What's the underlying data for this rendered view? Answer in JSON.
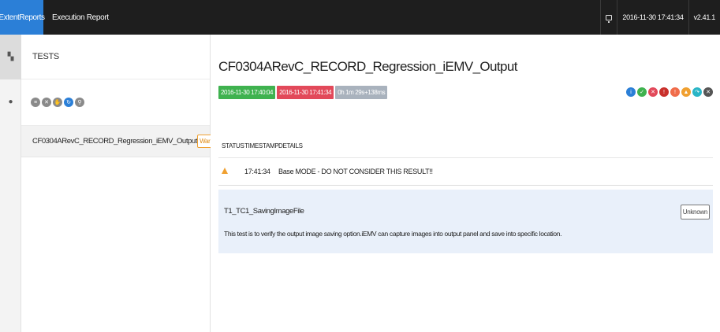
{
  "topbar": {
    "brand": "ExtentReports",
    "title": "Execution Report",
    "timestamp": "2016-11-30 17:41:34",
    "version": "v2.41.1"
  },
  "rail": {
    "items": [
      {
        "icon": "dashboard-icon",
        "glyph": "▚"
      },
      {
        "icon": "categories-icon",
        "glyph": "●"
      }
    ]
  },
  "panel": {
    "heading": "TESTS",
    "filters": [
      {
        "icon": "list-icon",
        "glyph": "≡"
      },
      {
        "icon": "close-icon",
        "glyph": "✕"
      },
      {
        "icon": "clear-icon",
        "glyph": "✋"
      },
      {
        "icon": "refresh-icon",
        "glyph": "↻"
      },
      {
        "icon": "search-icon",
        "glyph": "⚲"
      }
    ],
    "tests": [
      {
        "name": "CF0304ARevC_RECORD_Regression_iEMV_Output",
        "status": "Warning"
      }
    ]
  },
  "main": {
    "title": "CF0304ARevC_RECORD_Regression_iEMV_Output",
    "started": "2016-11-30 17:40:04",
    "ended": "2016-11-30 17:41:34",
    "duration": "0h 1m 29s+138ms",
    "colors": {
      "pass": "#3fb24f",
      "fail": "#e2495a",
      "time": "#a9b2bd",
      "warning": "#f0a030",
      "brand": "#2b7fd7"
    },
    "status_icons": [
      {
        "icon": "info-icon",
        "color": "#2b7fd7",
        "glyph": "i"
      },
      {
        "icon": "pass-icon",
        "color": "#3fb24f",
        "glyph": "✓"
      },
      {
        "icon": "fail-icon",
        "color": "#e2495a",
        "glyph": "✕"
      },
      {
        "icon": "fatal-icon",
        "color": "#c9302c",
        "glyph": "!"
      },
      {
        "icon": "error-icon",
        "color": "#f06c4a",
        "glyph": "!"
      },
      {
        "icon": "warning-icon",
        "color": "#f0a030",
        "glyph": "▲"
      },
      {
        "icon": "skip-icon",
        "color": "#2ab5c6",
        "glyph": "↷"
      },
      {
        "icon": "unknown-icon",
        "color": "#555555",
        "glyph": "✕"
      }
    ],
    "table": {
      "headers": [
        "STATUS",
        "TIMESTAMP",
        "DETAILS"
      ],
      "rows": [
        {
          "status": "warning",
          "timestamp": "17:41:34",
          "details": "Base MODE - DO NOT CONSIDER THIS RESULT!!"
        }
      ]
    },
    "node": {
      "name": "T1_TC1_SavingImageFile",
      "status": "Unknown",
      "description": "This test is to verify the output image saving option.iEMV can capture images into output panel and save into specific location."
    }
  }
}
